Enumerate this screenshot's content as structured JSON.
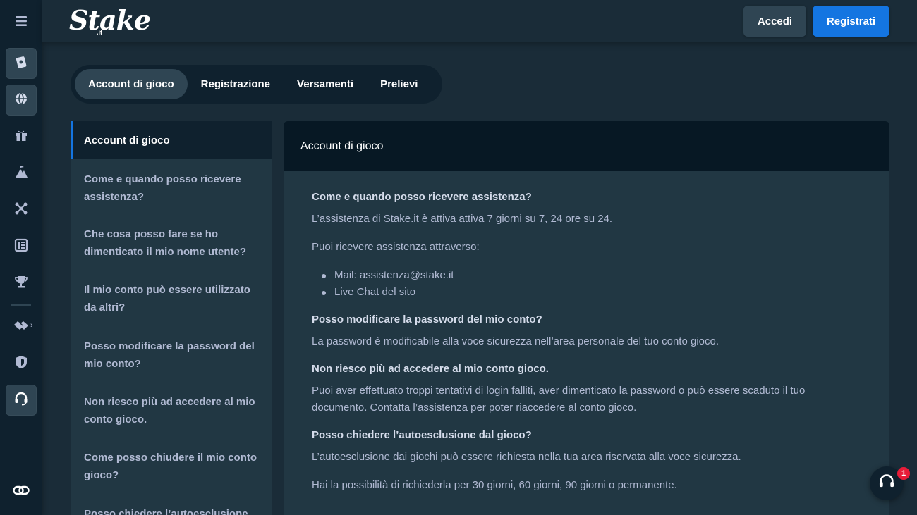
{
  "brand": {
    "logo": "Stake",
    "logo_sub": ".it"
  },
  "header": {
    "login_label": "Accedi",
    "register_label": "Registrati"
  },
  "rail": {
    "icons": [
      "menu-icon",
      "casino-icon",
      "sports-icon",
      "gift-icon",
      "mountain-icon",
      "network-icon",
      "news-icon",
      "trophy-icon",
      "handshake-icon",
      "shield-icon",
      "headset-icon",
      "link-icon"
    ]
  },
  "tabs": [
    {
      "label": "Account di gioco",
      "active": true
    },
    {
      "label": "Registrazione",
      "active": false
    },
    {
      "label": "Versamenti",
      "active": false
    },
    {
      "label": "Prelievi",
      "active": false
    }
  ],
  "sidebar": {
    "items": [
      "Account di gioco",
      "Come e quando posso ricevere assistenza?",
      "Che cosa posso fare se ho dimenticato il mio nome utente?",
      "Il mio conto può essere utilizzato da altri?",
      "Posso modificare la password del mio conto?",
      "Non riesco più ad accedere al mio conto gioco.",
      "Come posso chiudere il mio conto gioco?",
      "Posso chiedere l’autoesclusione dal gioco?"
    ]
  },
  "content": {
    "heading": "Account di gioco",
    "q1_title": "Come e quando posso ricevere assistenza?",
    "q1_p1": "L’assistenza di Stake.it è attiva attiva 7 giorni su 7, 24 ore su 24.",
    "q1_p2": "Puoi ricevere assistenza attraverso:",
    "q1_b1": "Mail: assistenza@stake.it",
    "q1_b2": "Live Chat del sito",
    "q2_title": "Posso modificare la password del mio conto?",
    "q2_p1": "La password è modificabile alla voce sicurezza nell’area personale del tuo conto gioco.",
    "q3_title": "Non riesco più ad accedere al mio conto gioco.",
    "q3_p1": "Puoi aver effettuato troppi tentativi di login falliti, aver dimenticato la password o può essere scaduto il tuo documento. Contatta l’assistenza per poter riaccedere al conto gioco.",
    "q4_title": "Posso chiedere l’autoesclusione dal gioco?",
    "q4_p1": "L’autoesclusione dai giochi può essere richiesta nella tua area riservata alla voce sicurezza.",
    "q4_p2": "Hai la possibilità di richiederla per 30 giorni, 60 giorni, 90 giorni o permanente."
  },
  "support": {
    "badge": "1"
  },
  "colors": {
    "accent": "#1475e1",
    "rail": "#0f212e",
    "page": "#1a2c38",
    "panel": "#213743",
    "badge": "#e81c38"
  }
}
